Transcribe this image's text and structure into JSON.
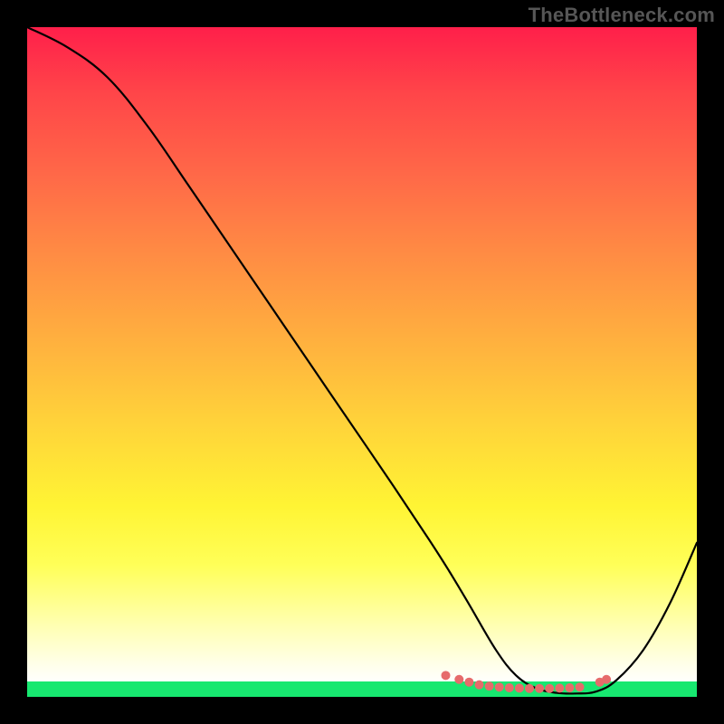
{
  "watermark": "TheBottleneck.com",
  "accent_colors": {
    "green_band": "#17e870",
    "dot_fill": "#e66b6b",
    "curve": "#000000"
  },
  "chart_data": {
    "type": "line",
    "title": "",
    "xlabel": "",
    "ylabel": "",
    "xlim": [
      0,
      100
    ],
    "ylim": [
      0,
      100
    ],
    "grid": false,
    "series": [
      {
        "name": "curve",
        "x": [
          0,
          6,
          12,
          18,
          24,
          30,
          36,
          42,
          48,
          54,
          60,
          63,
          66,
          70,
          73,
          76,
          79,
          82,
          85,
          88,
          92,
          96,
          100
        ],
        "values": [
          100,
          97,
          92.5,
          85.2,
          76.5,
          67.7,
          58.9,
          50.1,
          41.3,
          32.5,
          23.5,
          18.8,
          13.8,
          7.0,
          3.2,
          1.3,
          0.6,
          0.5,
          0.8,
          2.5,
          7.0,
          14.0,
          23.0
        ]
      }
    ],
    "annotations": {
      "bottom_dots": {
        "x": [
          62.5,
          64.5,
          66,
          67.5,
          69,
          70.5,
          72,
          73.5,
          75,
          76.5,
          78,
          79.5,
          81,
          82.5,
          85.5,
          86.5
        ],
        "values": [
          3.2,
          2.6,
          2.2,
          1.8,
          1.6,
          1.45,
          1.35,
          1.3,
          1.25,
          1.25,
          1.25,
          1.3,
          1.35,
          1.45,
          2.2,
          2.6
        ]
      }
    }
  }
}
